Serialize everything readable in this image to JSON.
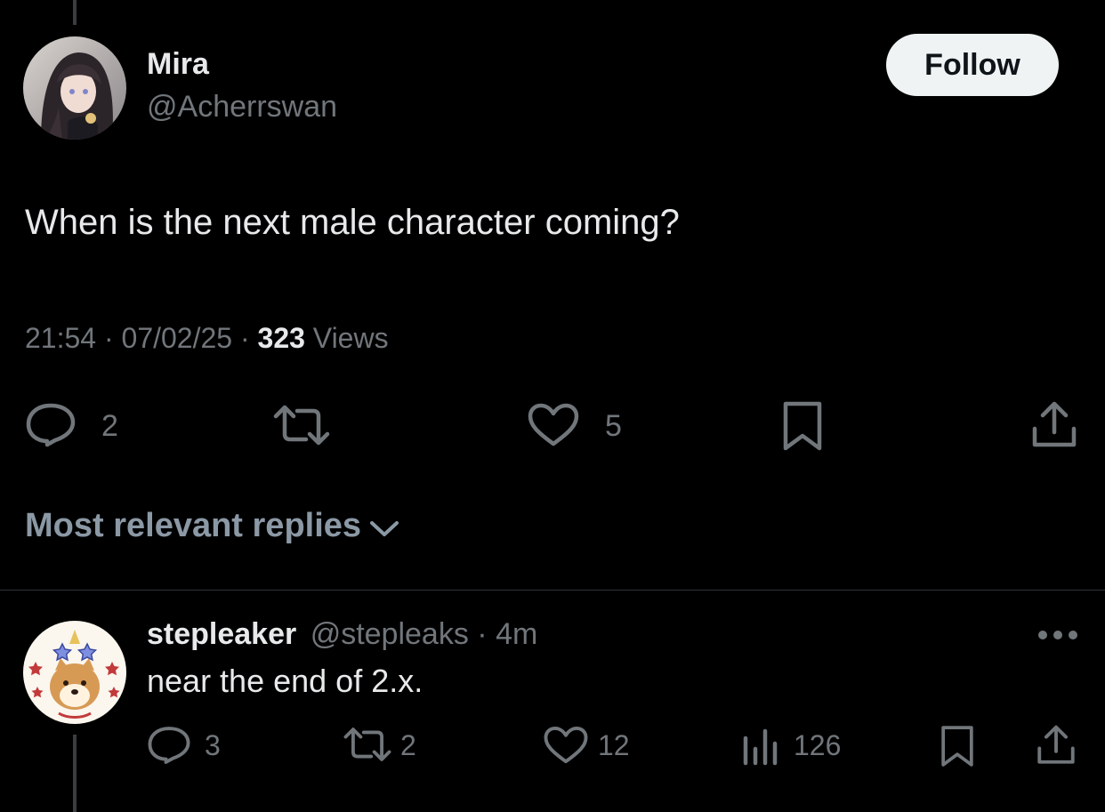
{
  "tweet": {
    "author_name": "Mira",
    "author_handle": "@Acherrswan",
    "follow_label": "Follow",
    "text": "When is the next male character coming?",
    "time": "21:54",
    "sep1": "·",
    "date": "07/02/25",
    "sep2": "·",
    "views_count": "323",
    "views_label": "Views",
    "actions": {
      "reply_count": "2",
      "retweet_count": "",
      "like_count": "5"
    }
  },
  "replies_filter": {
    "label": "Most relevant replies"
  },
  "reply": {
    "author_name": "stepleaker",
    "author_handle": "@stepleaks",
    "sep": "·",
    "time_ago": "4m",
    "text": "near the end of 2.x.",
    "actions": {
      "reply_count": "3",
      "retweet_count": "2",
      "like_count": "12",
      "views_count": "126"
    }
  },
  "colors": {
    "background": "#000000",
    "text": "#e7e9ea",
    "muted": "#71767b",
    "follow_bg": "#eff3f4"
  }
}
